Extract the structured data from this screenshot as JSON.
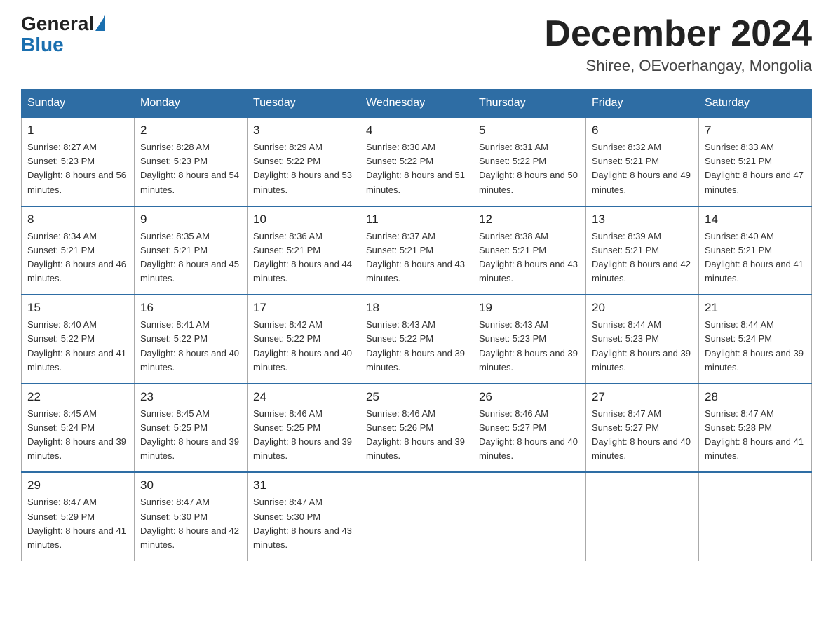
{
  "header": {
    "logo_general": "General",
    "logo_blue": "Blue",
    "month_title": "December 2024",
    "location": "Shiree, OEvoerhangay, Mongolia"
  },
  "weekdays": [
    "Sunday",
    "Monday",
    "Tuesday",
    "Wednesday",
    "Thursday",
    "Friday",
    "Saturday"
  ],
  "weeks": [
    [
      {
        "day": "1",
        "sunrise": "8:27 AM",
        "sunset": "5:23 PM",
        "daylight": "8 hours and 56 minutes."
      },
      {
        "day": "2",
        "sunrise": "8:28 AM",
        "sunset": "5:23 PM",
        "daylight": "8 hours and 54 minutes."
      },
      {
        "day": "3",
        "sunrise": "8:29 AM",
        "sunset": "5:22 PM",
        "daylight": "8 hours and 53 minutes."
      },
      {
        "day": "4",
        "sunrise": "8:30 AM",
        "sunset": "5:22 PM",
        "daylight": "8 hours and 51 minutes."
      },
      {
        "day": "5",
        "sunrise": "8:31 AM",
        "sunset": "5:22 PM",
        "daylight": "8 hours and 50 minutes."
      },
      {
        "day": "6",
        "sunrise": "8:32 AM",
        "sunset": "5:21 PM",
        "daylight": "8 hours and 49 minutes."
      },
      {
        "day": "7",
        "sunrise": "8:33 AM",
        "sunset": "5:21 PM",
        "daylight": "8 hours and 47 minutes."
      }
    ],
    [
      {
        "day": "8",
        "sunrise": "8:34 AM",
        "sunset": "5:21 PM",
        "daylight": "8 hours and 46 minutes."
      },
      {
        "day": "9",
        "sunrise": "8:35 AM",
        "sunset": "5:21 PM",
        "daylight": "8 hours and 45 minutes."
      },
      {
        "day": "10",
        "sunrise": "8:36 AM",
        "sunset": "5:21 PM",
        "daylight": "8 hours and 44 minutes."
      },
      {
        "day": "11",
        "sunrise": "8:37 AM",
        "sunset": "5:21 PM",
        "daylight": "8 hours and 43 minutes."
      },
      {
        "day": "12",
        "sunrise": "8:38 AM",
        "sunset": "5:21 PM",
        "daylight": "8 hours and 43 minutes."
      },
      {
        "day": "13",
        "sunrise": "8:39 AM",
        "sunset": "5:21 PM",
        "daylight": "8 hours and 42 minutes."
      },
      {
        "day": "14",
        "sunrise": "8:40 AM",
        "sunset": "5:21 PM",
        "daylight": "8 hours and 41 minutes."
      }
    ],
    [
      {
        "day": "15",
        "sunrise": "8:40 AM",
        "sunset": "5:22 PM",
        "daylight": "8 hours and 41 minutes."
      },
      {
        "day": "16",
        "sunrise": "8:41 AM",
        "sunset": "5:22 PM",
        "daylight": "8 hours and 40 minutes."
      },
      {
        "day": "17",
        "sunrise": "8:42 AM",
        "sunset": "5:22 PM",
        "daylight": "8 hours and 40 minutes."
      },
      {
        "day": "18",
        "sunrise": "8:43 AM",
        "sunset": "5:22 PM",
        "daylight": "8 hours and 39 minutes."
      },
      {
        "day": "19",
        "sunrise": "8:43 AM",
        "sunset": "5:23 PM",
        "daylight": "8 hours and 39 minutes."
      },
      {
        "day": "20",
        "sunrise": "8:44 AM",
        "sunset": "5:23 PM",
        "daylight": "8 hours and 39 minutes."
      },
      {
        "day": "21",
        "sunrise": "8:44 AM",
        "sunset": "5:24 PM",
        "daylight": "8 hours and 39 minutes."
      }
    ],
    [
      {
        "day": "22",
        "sunrise": "8:45 AM",
        "sunset": "5:24 PM",
        "daylight": "8 hours and 39 minutes."
      },
      {
        "day": "23",
        "sunrise": "8:45 AM",
        "sunset": "5:25 PM",
        "daylight": "8 hours and 39 minutes."
      },
      {
        "day": "24",
        "sunrise": "8:46 AM",
        "sunset": "5:25 PM",
        "daylight": "8 hours and 39 minutes."
      },
      {
        "day": "25",
        "sunrise": "8:46 AM",
        "sunset": "5:26 PM",
        "daylight": "8 hours and 39 minutes."
      },
      {
        "day": "26",
        "sunrise": "8:46 AM",
        "sunset": "5:27 PM",
        "daylight": "8 hours and 40 minutes."
      },
      {
        "day": "27",
        "sunrise": "8:47 AM",
        "sunset": "5:27 PM",
        "daylight": "8 hours and 40 minutes."
      },
      {
        "day": "28",
        "sunrise": "8:47 AM",
        "sunset": "5:28 PM",
        "daylight": "8 hours and 41 minutes."
      }
    ],
    [
      {
        "day": "29",
        "sunrise": "8:47 AM",
        "sunset": "5:29 PM",
        "daylight": "8 hours and 41 minutes."
      },
      {
        "day": "30",
        "sunrise": "8:47 AM",
        "sunset": "5:30 PM",
        "daylight": "8 hours and 42 minutes."
      },
      {
        "day": "31",
        "sunrise": "8:47 AM",
        "sunset": "5:30 PM",
        "daylight": "8 hours and 43 minutes."
      },
      null,
      null,
      null,
      null
    ]
  ]
}
